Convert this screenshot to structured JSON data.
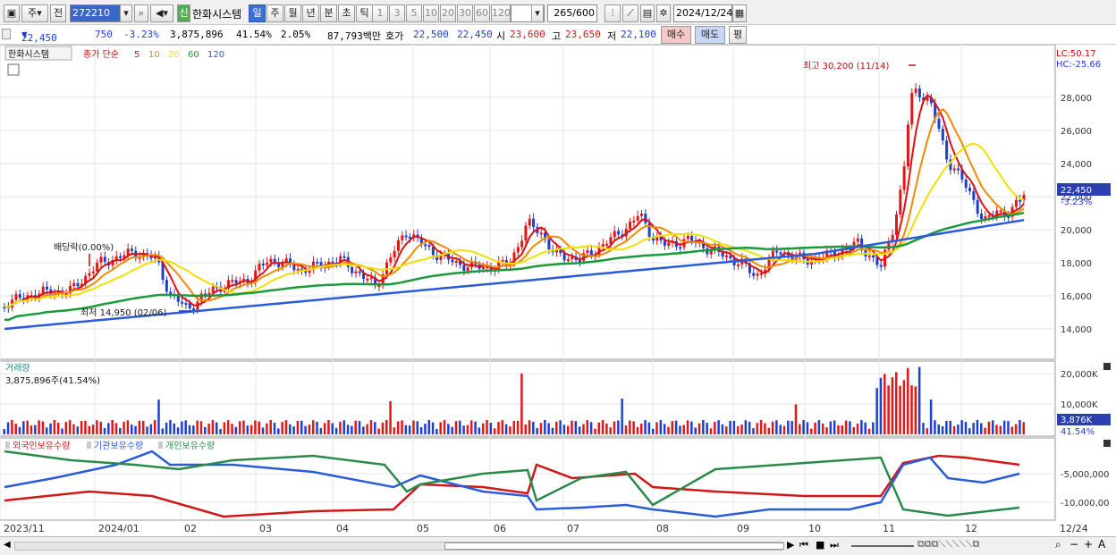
{
  "toolbar": {
    "type_label": "주",
    "prev_label": "전",
    "code": "272210",
    "stock_name": "한화시스템",
    "period_tabs": [
      "일",
      "주",
      "월",
      "년",
      "분",
      "초",
      "틱"
    ],
    "active_tab": "일",
    "minute_options": [
      "1",
      "3",
      "5",
      "10",
      "20",
      "30",
      "60",
      "120"
    ],
    "count": "265",
    "count_max": "/600",
    "date": "2024/12/24",
    "badge": "신"
  },
  "quote": {
    "price": "22,450",
    "change": "750",
    "rate": "-3.23%",
    "volume": "3,875,896",
    "turnover_ratio": "41.54%",
    "extra_rate": "2.05%",
    "amount": "87,793백만",
    "bid_label": "호가",
    "bid1": "22,500",
    "bid2": "22,450",
    "open_label": "시",
    "open": "23,600",
    "high_label": "고",
    "high": "23,650",
    "low_label": "저",
    "low": "22,100",
    "buy_label": "매수",
    "sell_label": "매도",
    "eval_label": "평"
  },
  "price_panel": {
    "legend_name": "한화시스템",
    "legend_ma_label": "종가 단순",
    "ma_periods": [
      "5",
      "10",
      "20",
      "60",
      "120"
    ],
    "ma_colors": [
      "#e01010",
      "#f08a00",
      "#f0e000",
      "#1a9a3a",
      "#2a5bd8"
    ],
    "lc": "LC:50.17",
    "hc": "HC:-25.66",
    "max_note": "최고 30,200 (11/14)",
    "min_note": "최저 14,950 (02/06)",
    "dividend_note": "배당락(0.00%)",
    "current_price": "22,450",
    "current_rate": "-3.23%",
    "y_ticks": [
      "28,000",
      "26,000",
      "24,000",
      "22,000",
      "20,000",
      "18,000",
      "16,000",
      "14,000"
    ]
  },
  "volume_panel": {
    "title": "거래량",
    "value_label": "3,875,896주(41.54%)",
    "y_ticks": [
      "20,000K",
      "10,000K"
    ],
    "current": "3,876K",
    "current_pct": "41.54%"
  },
  "holdings_panel": {
    "legends": [
      "외국인보유수량",
      "기관보유수량",
      "개인보유수량"
    ],
    "legend_colors": [
      "#d01818",
      "#2a5bd8",
      "#2a8a4a"
    ],
    "y_ticks": [
      "-5,000,000",
      "-10,000,00"
    ]
  },
  "x_axis": {
    "labels": [
      "2023/11",
      "2024/01",
      "02",
      "03",
      "04",
      "05",
      "06",
      "07",
      "08",
      "09",
      "10",
      "11",
      "12",
      "12/24"
    ]
  }
}
